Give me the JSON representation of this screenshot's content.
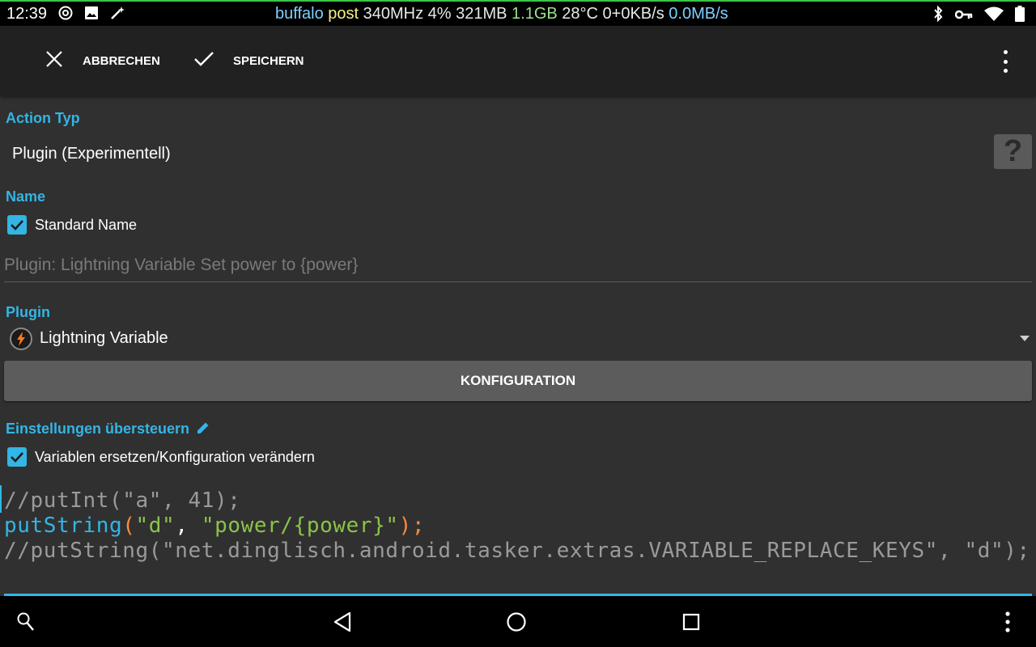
{
  "status_bar": {
    "time": "12:39",
    "left_icons": [
      "at-sign-icon",
      "image-icon",
      "magic-wand-icon"
    ],
    "info_segments": [
      {
        "text": "buffalo ",
        "color": "#7fd0ff"
      },
      {
        "text": "post ",
        "color": "#f4f08a"
      },
      {
        "text": "340MHz 4% 321MB ",
        "color": "#e8e8e8"
      },
      {
        "text": "1.1GB ",
        "color": "#9be28f"
      },
      {
        "text": "28°C 0+0KB/s ",
        "color": "#e8e8e8"
      },
      {
        "text": "0.0MB/s",
        "color": "#7fd0ff"
      }
    ],
    "right_icons": [
      "bluetooth-icon",
      "key-icon",
      "wifi-icon",
      "battery-icon"
    ]
  },
  "toolbar": {
    "cancel_label": "ABBRECHEN",
    "save_label": "SPEICHERN"
  },
  "action_type": {
    "section_label": "Action Typ",
    "value": "Plugin (Experimentell)",
    "help_label": "?"
  },
  "name": {
    "section_label": "Name",
    "standard_name_label": "Standard Name",
    "standard_name_checked": true,
    "placeholder": "Plugin: Lightning Variable Set power to {power}"
  },
  "plugin": {
    "section_label": "Plugin",
    "selected": "Lightning Variable",
    "configure_label": "KONFIGURATION"
  },
  "override": {
    "section_label": "Einstellungen übersteuern",
    "replace_label": "Variablen ersetzen/Konfiguration verändern",
    "replace_checked": true
  },
  "code": {
    "line1": "//putInt(\"a\", 41);",
    "line2": {
      "func": "putString",
      "open": "(",
      "arg1": "\"d\"",
      "sep": ", ",
      "arg2": "\"power/{power}\"",
      "close": ")",
      "semi": ";"
    },
    "line3": "//putString(\"net.dinglisch.android.tasker.extras.VARIABLE_REPLACE_KEYS\", \"d\");"
  },
  "colors": {
    "accent": "#33b5e5",
    "code_comment": "#9a9a9a",
    "code_func": "#33b5e5",
    "code_string": "#8bc34a",
    "code_punct": "#ff8a3d",
    "background": "#303030",
    "toolbar": "#212121"
  },
  "nav_bar": {
    "icons": [
      "search-icon",
      "back-icon",
      "home-icon",
      "recents-icon",
      "overflow-icon"
    ]
  }
}
